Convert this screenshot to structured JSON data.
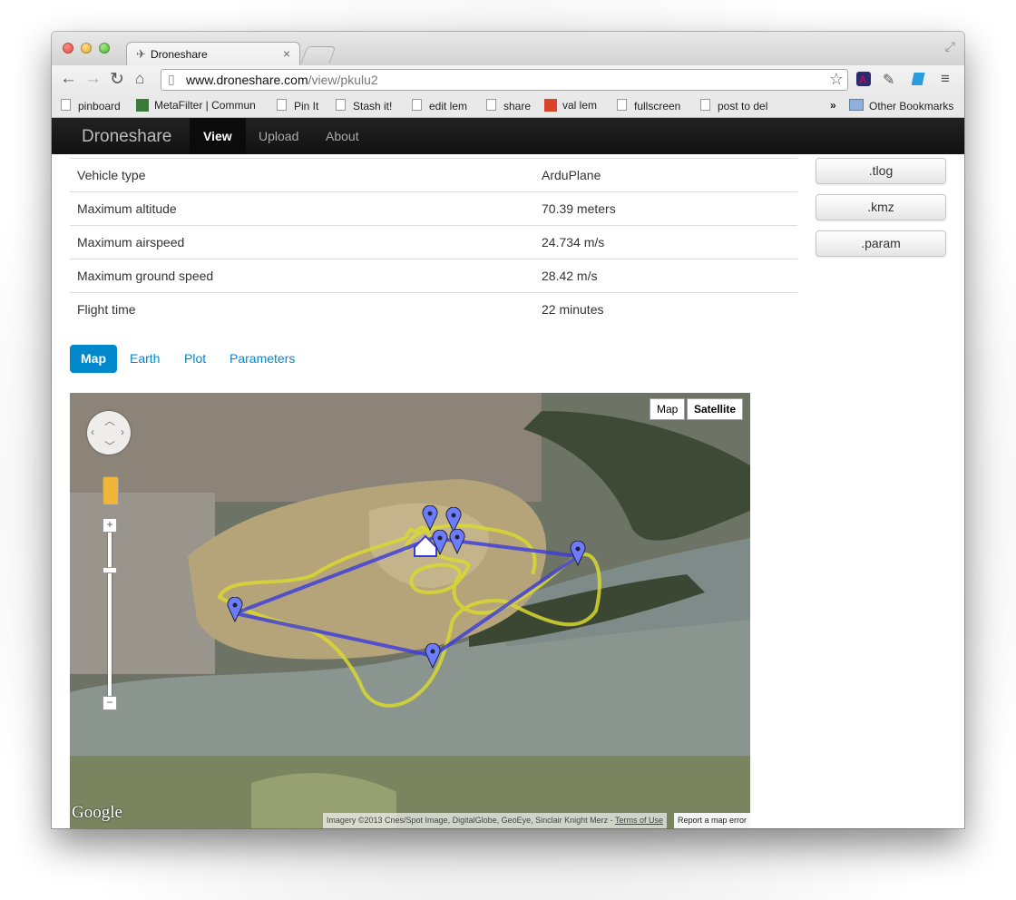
{
  "browser": {
    "tab_title": "Droneshare",
    "url_domain": "www.droneshare.com",
    "url_path": "/view/pkulu2",
    "bookmarks": [
      "pinboard",
      "MetaFilter | Commun",
      "Pin It",
      "Stash it!",
      "edit lem",
      "share",
      "val lem",
      "fullscreen",
      "post to del"
    ],
    "more_bookmarks": "»",
    "other_bookmarks": "Other Bookmarks"
  },
  "nav": {
    "brand": "Droneshare",
    "links": [
      "View",
      "Upload",
      "About"
    ]
  },
  "flight_info": {
    "rows": [
      {
        "label": "Vehicle type",
        "value": "ArduPlane"
      },
      {
        "label": "Maximum altitude",
        "value": "70.39 meters"
      },
      {
        "label": "Maximum airspeed",
        "value": "24.734 m/s"
      },
      {
        "label": "Maximum ground speed",
        "value": "28.42 m/s"
      },
      {
        "label": "Flight time",
        "value": "22 minutes"
      }
    ]
  },
  "downloads": [
    ".tlog",
    ".kmz",
    ".param"
  ],
  "view_tabs": [
    "Map",
    "Earth",
    "Plot",
    "Parameters"
  ],
  "map": {
    "type_buttons": [
      "Map",
      "Satellite"
    ],
    "selected_type": "Satellite",
    "zoom_in": "+",
    "zoom_out": "−",
    "logo": "Google",
    "attribution": "Imagery ©2013 Cnes/Spot Image, DigitalGlobe, GeoEye, Sinclair Knight Merz - ",
    "terms": "Terms of Use",
    "report": "Report a map error",
    "colors": {
      "track": "#d8d830",
      "route": "#3a3ae0",
      "marker": "#6b7cff"
    }
  }
}
